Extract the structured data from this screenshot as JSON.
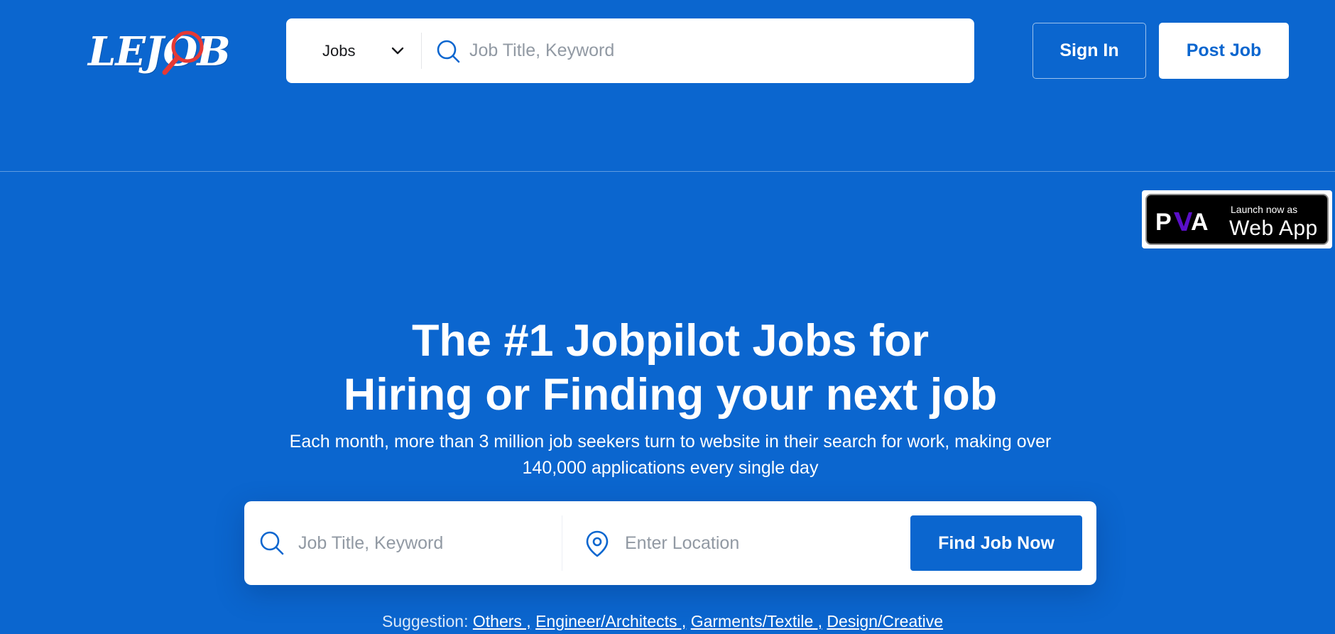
{
  "brand": {
    "logo_text": "LEJOB",
    "colors": {
      "primary": "#0b66cf",
      "logo_lens": "#e53935",
      "white": "#ffffff"
    }
  },
  "header": {
    "category_select": {
      "value": "Jobs",
      "icon": "chevron-down-icon"
    },
    "search": {
      "placeholder": "Job Title, Keyword",
      "icon": "search-icon"
    },
    "sign_in_label": "Sign In",
    "post_job_label": "Post Job"
  },
  "pwa_badge": {
    "logo_text": "PWA",
    "small_text": "Launch now as",
    "big_text": "Web App"
  },
  "hero": {
    "title_part1": "The ",
    "title_bold": "#1 Jobpilot Jobs",
    "title_part2": " for",
    "title_line2": "Hiring or Finding your next job",
    "subtitle": "Each month, more than 3 million job seekers turn to website in their search for work, making over 140,000 applications every single day"
  },
  "main_search": {
    "keyword_placeholder": "Job Title, Keyword",
    "location_placeholder": "Enter Location",
    "button_label": "Find Job Now",
    "keyword_icon": "search-icon",
    "location_icon": "map-pin-icon"
  },
  "suggestions": {
    "label": "Suggestion: ",
    "items": [
      "Others ,",
      "Engineer/Architects ,",
      "Garments/Textile ,",
      "Design/Creative"
    ]
  }
}
